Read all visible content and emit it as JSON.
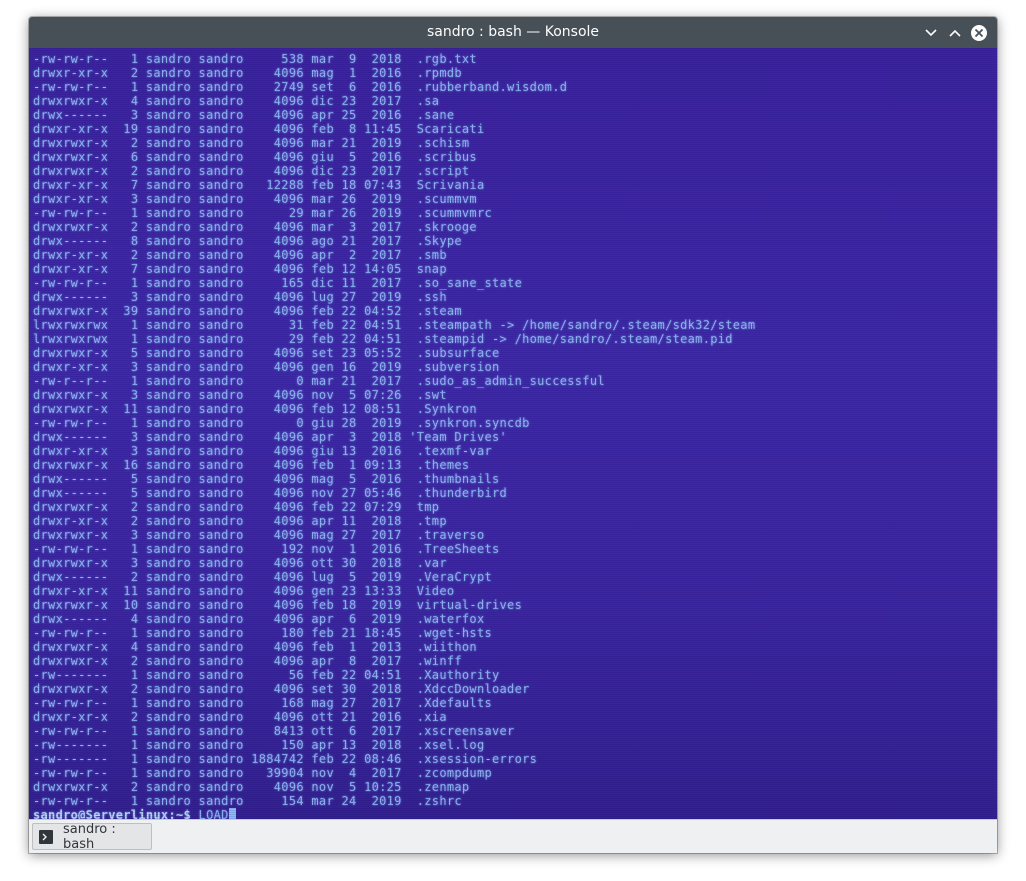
{
  "window": {
    "title": "sandro : bash — Konsole"
  },
  "terminal": {
    "lines": [
      "-rw-rw-r--   1 sandro sandro     538 mar  9  2018  .rgb.txt",
      "drwxr-xr-x   2 sandro sandro    4096 mag  1  2016  .rpmdb",
      "-rw-rw-r--   1 sandro sandro    2749 set  6  2016  .rubberband.wisdom.d",
      "drwxrwxr-x   4 sandro sandro    4096 dic 23  2017  .sa",
      "drwx------   3 sandro sandro    4096 apr 25  2016  .sane",
      "drwxr-xr-x  19 sandro sandro    4096 feb  8 11:45  Scaricati",
      "drwxrwxr-x   2 sandro sandro    4096 mar 21  2019  .schism",
      "drwxrwxr-x   6 sandro sandro    4096 giu  5  2016  .scribus",
      "drwxrwxr-x   2 sandro sandro    4096 dic 23  2017  .script",
      "drwxr-xr-x   7 sandro sandro   12288 feb 18 07:43  Scrivania",
      "drwxr-xr-x   3 sandro sandro    4096 mar 26  2019  .scummvm",
      "-rw-rw-r--   1 sandro sandro      29 mar 26  2019  .scummvmrc",
      "drwxrwxr-x   2 sandro sandro    4096 mar  3  2017  .skrooge",
      "drwx------   8 sandro sandro    4096 ago 21  2017  .Skype",
      "drwxr-xr-x   2 sandro sandro    4096 apr  2  2017  .smb",
      "drwxr-xr-x   7 sandro sandro    4096 feb 12 14:05  snap",
      "-rw-rw-r--   1 sandro sandro     165 dic 11  2017  .so_sane_state",
      "drwx------   3 sandro sandro    4096 lug 27  2019  .ssh",
      "drwxrwxr-x  39 sandro sandro    4096 feb 22 04:52  .steam",
      "lrwxrwxrwx   1 sandro sandro      31 feb 22 04:51  .steampath -> /home/sandro/.steam/sdk32/steam",
      "lrwxrwxrwx   1 sandro sandro      29 feb 22 04:51  .steampid -> /home/sandro/.steam/steam.pid",
      "drwxrwxr-x   5 sandro sandro    4096 set 23 05:52  .subsurface",
      "drwxr-xr-x   3 sandro sandro    4096 gen 16  2019  .subversion",
      "-rw-r--r--   1 sandro sandro       0 mar 21  2017  .sudo_as_admin_successful",
      "drwxrwxr-x   3 sandro sandro    4096 nov  5 07:26  .swt",
      "drwxrwxr-x  11 sandro sandro    4096 feb 12 08:51  .Synkron",
      "-rw-rw-r--   1 sandro sandro       0 giu 28  2019  .synkron.syncdb",
      "drwx------   3 sandro sandro    4096 apr  3  2018 'Team Drives'",
      "drwxr-xr-x   3 sandro sandro    4096 giu 13  2016  .texmf-var",
      "drwxrwxr-x  16 sandro sandro    4096 feb  1 09:13  .themes",
      "drwx------   5 sandro sandro    4096 mag  5  2016  .thumbnails",
      "drwx------   5 sandro sandro    4096 nov 27 05:46  .thunderbird",
      "drwxrwxr-x   2 sandro sandro    4096 feb 22 07:29  tmp",
      "drwxr-xr-x   2 sandro sandro    4096 apr 11  2018  .tmp",
      "drwxrwxr-x   3 sandro sandro    4096 mag 27  2017  .traverso",
      "-rw-rw-r--   1 sandro sandro     192 nov  1  2016  .TreeSheets",
      "drwxrwxr-x   3 sandro sandro    4096 ott 30  2018  .var",
      "drwx------   2 sandro sandro    4096 lug  5  2019  .VeraCrypt",
      "drwxr-xr-x  11 sandro sandro    4096 gen 23 13:33  Video",
      "drwxrwxr-x  10 sandro sandro    4096 feb 18  2019  virtual-drives",
      "drwx------   4 sandro sandro    4096 apr  6  2019  .waterfox",
      "-rw-rw-r--   1 sandro sandro     180 feb 21 18:45  .wget-hsts",
      "drwxrwxr-x   4 sandro sandro    4096 feb  1  2013  .wiithon",
      "drwxrwxr-x   2 sandro sandro    4096 apr  8  2017  .winff",
      "-rw-------   1 sandro sandro      56 feb 22 04:51  .Xauthority",
      "drwxrwxr-x   2 sandro sandro    4096 set 30  2018  .XdccDownloader",
      "-rw-rw-r--   1 sandro sandro     168 mag 27  2017  .Xdefaults",
      "drwxr-xr-x   2 sandro sandro    4096 ott 21  2016  .xia",
      "-rw-rw-r--   1 sandro sandro    8413 ott  6  2017  .xscreensaver",
      "-rw-------   1 sandro sandro     150 apr 13  2018  .xsel.log",
      "-rw-------   1 sandro sandro 1884742 feb 22 08:46  .xsession-errors",
      "-rw-rw-r--   1 sandro sandro   39904 nov  4  2017  .zcompdump",
      "drwxrwxr-x   2 sandro sandro    4096 nov  5 10:25  .zenmap",
      "-rw-rw-r--   1 sandro sandro     154 mar 24  2019  .zshrc"
    ],
    "prompt": "sandro@Serverlinux:~$",
    "command": " LOAD"
  },
  "tabbar": {
    "tabs": [
      {
        "label": "sandro : bash",
        "icon": "terminal-icon"
      }
    ]
  },
  "icons": {
    "minimize": "chevron-down-icon",
    "maximize": "chevron-up-icon",
    "close": "close-icon"
  },
  "colors": {
    "titlebar": "#475057",
    "terminal_bg": "#3d26ac",
    "terminal_text": "#8fb8ff"
  }
}
